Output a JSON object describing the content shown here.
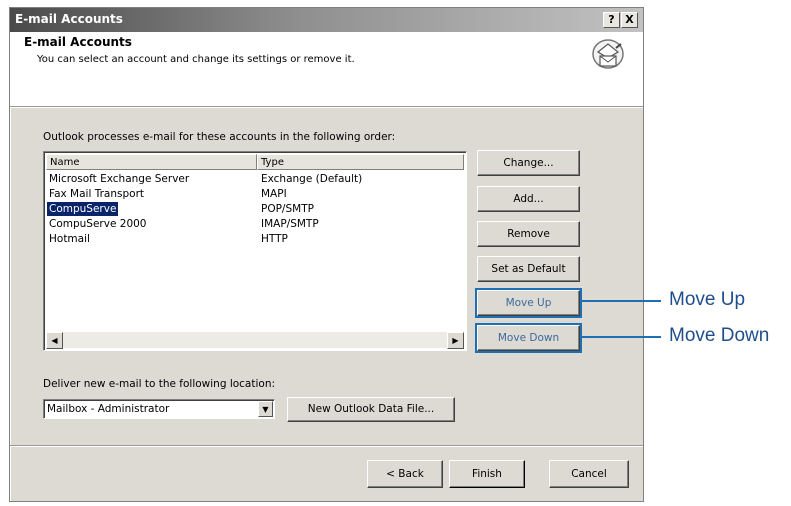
{
  "window": {
    "title": "E-mail Accounts",
    "help_btn": "?",
    "close_btn": "X"
  },
  "header": {
    "title": "E-mail Accounts",
    "subtitle": "You can select an account and change its settings or remove it."
  },
  "accounts": {
    "label": "Outlook processes e-mail for these accounts in the following order:",
    "columns": [
      "Name",
      "Type"
    ],
    "rows": [
      {
        "name": "Microsoft Exchange Server",
        "type": "Exchange (Default)"
      },
      {
        "name": "Fax Mail Transport",
        "type": "MAPI"
      },
      {
        "name": "CompuServe",
        "type": "POP/SMTP",
        "selected": true
      },
      {
        "name": "CompuServe 2000",
        "type": "IMAP/SMTP"
      },
      {
        "name": "Hotmail",
        "type": "HTTP"
      }
    ]
  },
  "buttons": {
    "change": "Change...",
    "add": "Add...",
    "remove": "Remove",
    "set_default": "Set as Default",
    "move_up": "Move Up",
    "move_down": "Move Down"
  },
  "delivery": {
    "label": "Deliver new e-mail to the following location:",
    "value": "Mailbox - Administrator",
    "new_file": "New Outlook Data File..."
  },
  "footer": {
    "back": "< Back",
    "finish": "Finish",
    "cancel": "Cancel"
  },
  "callouts": {
    "move_up": "Move Up",
    "move_down": "Move Down"
  },
  "colors": {
    "callout": "#1f6fb5",
    "selection": "#0a246a"
  }
}
